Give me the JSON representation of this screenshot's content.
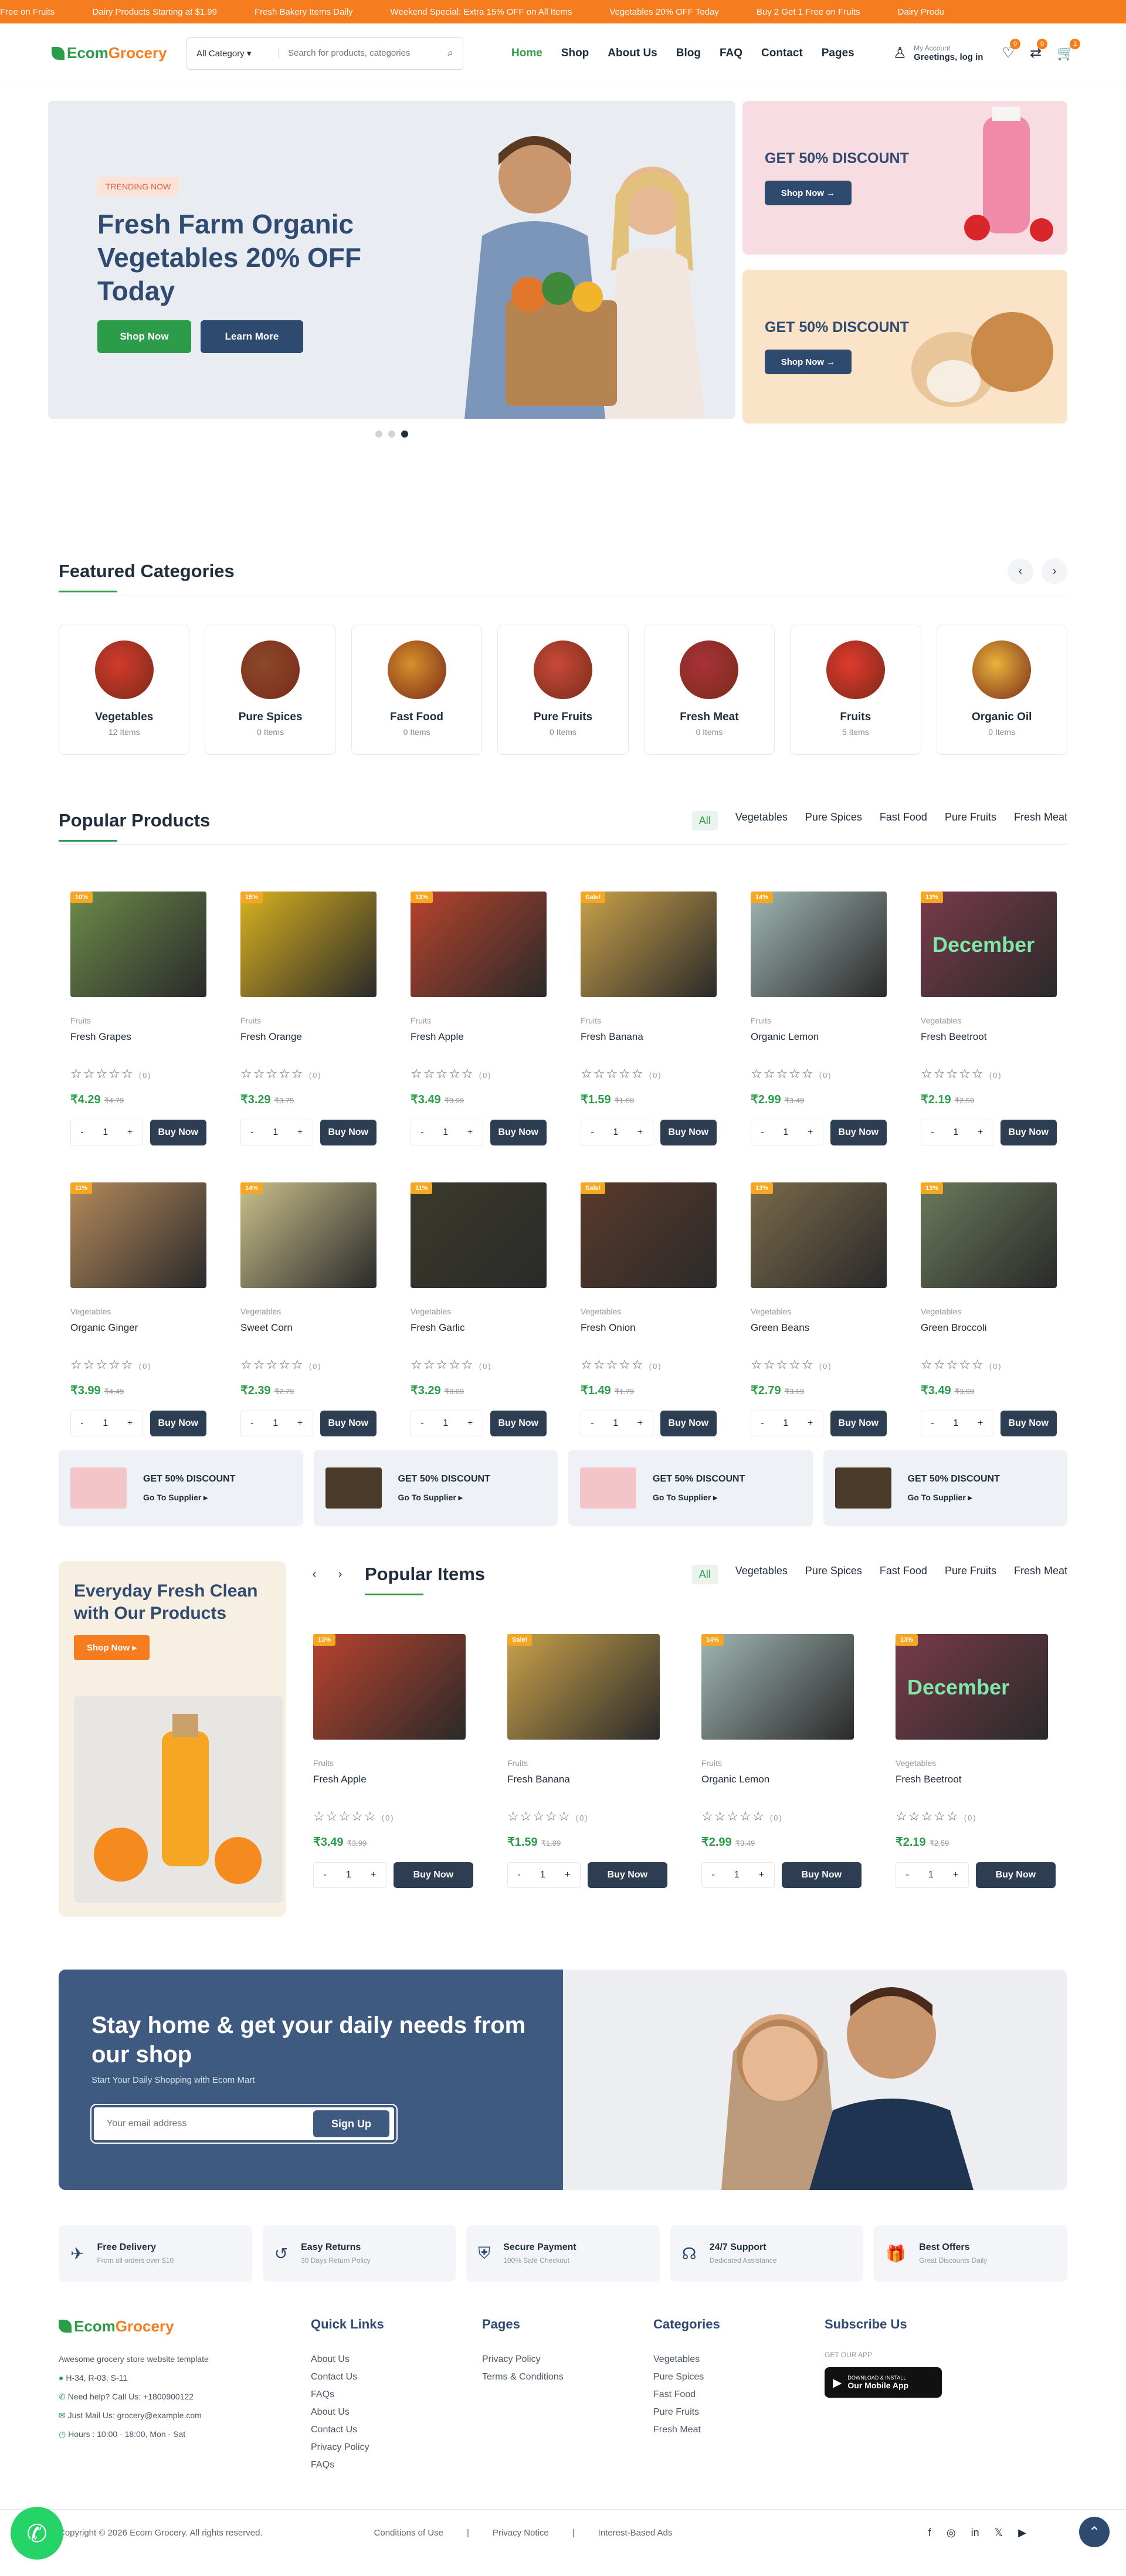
{
  "ticker": [
    "Free on Fruits",
    "Dairy Products Starting at $1.99",
    "Fresh Bakery Items Daily",
    "Weekend Special: Extra 15% OFF on All Items",
    "Vegetables 20% OFF Today",
    "Buy 2 Get 1 Free on Fruits",
    "Dairy Produ"
  ],
  "header": {
    "logo_a": "Ecom",
    "logo_b": "Grocery",
    "category": "All Category",
    "search_placeholder": "Search for products, categories",
    "account_small": "My Account",
    "account_big": "Greetings, log in",
    "wish_count": "0",
    "compare_count": "0",
    "cart_count": "1"
  },
  "nav": [
    "Home",
    "Shop",
    "About Us",
    "Blog",
    "FAQ",
    "Contact",
    "Pages"
  ],
  "hero": {
    "badge": "TRENDING NOW",
    "title": "Fresh Farm Organic Vegetables 20% OFF Today",
    "shop_btn": "Shop Now",
    "learn_btn": "Learn More",
    "side1_title": "GET 50% DISCOUNT",
    "side1_btn": "Shop Now →",
    "side2_title": "GET 50% DISCOUNT",
    "side2_btn": "Shop Now →"
  },
  "featured": {
    "title": "Featured Categories",
    "items": [
      {
        "name": "Vegetables",
        "count": "12 Items",
        "color": "#d33b2c"
      },
      {
        "name": "Pure Spices",
        "count": "0 Items",
        "color": "#8b4a2a"
      },
      {
        "name": "Fast Food",
        "count": "0 Items",
        "color": "#d6902a"
      },
      {
        "name": "Pure Fruits",
        "count": "0 Items",
        "color": "#c94a3a"
      },
      {
        "name": "Fresh Meat",
        "count": "0 Items",
        "color": "#a8323a"
      },
      {
        "name": "Fruits",
        "count": "5 Items",
        "color": "#e03a2c"
      },
      {
        "name": "Organic Oil",
        "count": "0 Items",
        "color": "#e8b43a"
      }
    ]
  },
  "tabs": [
    "All",
    "Vegetables",
    "Pure Spices",
    "Fast Food",
    "Pure Fruits",
    "Fresh Meat"
  ],
  "popular_products": {
    "title": "Popular Products",
    "items": [
      {
        "badge": "10%",
        "cat": "Fruits",
        "name": "Fresh Grapes",
        "price": "₹4.29",
        "old": "₹4.79",
        "color": "#6c8b4a"
      },
      {
        "badge": "15%",
        "cat": "Fruits",
        "name": "Fresh Orange",
        "price": "₹3.29",
        "old": "₹3.75",
        "color": "#d9b21f"
      },
      {
        "badge": "13%",
        "cat": "Fruits",
        "name": "Fresh Apple",
        "price": "₹3.49",
        "old": "₹3.99",
        "color": "#b8432c"
      },
      {
        "badge": "Sale!",
        "cat": "Fruits",
        "name": "Fresh Banana",
        "price": "₹1.59",
        "old": "₹1.89",
        "color": "#c9a24a"
      },
      {
        "badge": "14%",
        "cat": "Fruits",
        "name": "Organic Lemon",
        "price": "₹2.99",
        "old": "₹3.49",
        "color": "#9fb6b2"
      },
      {
        "badge": "13%",
        "cat": "Vegetables",
        "name": "Fresh Beetroot",
        "price": "₹2.19",
        "old": "₹2.59",
        "color": "#7a3a4a"
      },
      {
        "badge": "11%",
        "cat": "Vegetables",
        "name": "Organic Ginger",
        "price": "₹3.99",
        "old": "₹4.49",
        "color": "#b58a5a"
      },
      {
        "badge": "14%",
        "cat": "Vegetables",
        "name": "Sweet Corn",
        "price": "₹2.39",
        "old": "₹2.79",
        "color": "#c9c08a"
      },
      {
        "badge": "11%",
        "cat": "Vegetables",
        "name": "Fresh Garlic",
        "price": "₹3.29",
        "old": "₹3.69",
        "color": "#3a3a2a"
      },
      {
        "badge": "Sale!",
        "cat": "Vegetables",
        "name": "Fresh Onion",
        "price": "₹1.49",
        "old": "₹1.79",
        "color": "#5a3a2a"
      },
      {
        "badge": "13%",
        "cat": "Vegetables",
        "name": "Green Beans",
        "price": "₹2.79",
        "old": "₹3.19",
        "color": "#7a6a4a"
      },
      {
        "badge": "13%",
        "cat": "Vegetables",
        "name": "Green Broccoli",
        "price": "₹3.49",
        "old": "₹3.99",
        "color": "#6a7a5a"
      }
    ]
  },
  "stars": "☆☆☆☆☆",
  "reviews": "(0)",
  "qty": {
    "minus": "-",
    "value": "1",
    "plus": "+"
  },
  "buy": "Buy Now",
  "promos": [
    {
      "title": "GET 50% DISCOUNT",
      "link": "Go To Supplier ▸",
      "color": "#f3c5c8"
    },
    {
      "title": "GET 50% DISCOUNT",
      "link": "Go To Supplier ▸",
      "color": "#4a3a2a"
    },
    {
      "title": "GET 50% DISCOUNT",
      "link": "Go To Supplier ▸",
      "color": "#f3c5c8"
    },
    {
      "title": "GET 50% DISCOUNT",
      "link": "Go To Supplier ▸",
      "color": "#4a3a2a"
    }
  ],
  "popular_items": {
    "title": "Popular Items",
    "side_title": "Everyday Fresh Clean with Our Products",
    "side_btn": "Shop Now ▸",
    "items": [
      {
        "badge": "13%",
        "cat": "Fruits",
        "name": "Fresh Apple",
        "price": "₹3.49",
        "old": "₹3.99",
        "color": "#b8432c"
      },
      {
        "badge": "Sale!",
        "cat": "Fruits",
        "name": "Fresh Banana",
        "price": "₹1.59",
        "old": "₹1.89",
        "color": "#c9a24a"
      },
      {
        "badge": "14%",
        "cat": "Fruits",
        "name": "Organic Lemon",
        "price": "₹2.99",
        "old": "₹3.49",
        "color": "#9fb6b2"
      },
      {
        "badge": "13%",
        "cat": "Vegetables",
        "name": "Fresh Beetroot",
        "price": "₹2.19",
        "old": "₹2.59",
        "color": "#7a3a4a"
      }
    ]
  },
  "beetroot_overlay": "December",
  "newsletter": {
    "title": "Stay home & get your daily needs from our shop",
    "subtitle": "Start Your Daily Shopping with Ecom Mart",
    "placeholder": "Your email address",
    "button": "Sign Up"
  },
  "features": [
    {
      "title": "Free Delivery",
      "sub": "From all orders over $10",
      "icon": "✈"
    },
    {
      "title": "Easy Returns",
      "sub": "30 Days Return Policy",
      "icon": "↺"
    },
    {
      "title": "Secure Payment",
      "sub": "100% Safe Checkout",
      "icon": "⛨"
    },
    {
      "title": "24/7 Support",
      "sub": "Dedicated Assistance",
      "icon": "☊"
    },
    {
      "title": "Best Offers",
      "sub": "Great Discounts Daily",
      "icon": "🎁"
    }
  ],
  "footer": {
    "about": "Awesome grocery store website template",
    "address": "H-34, R-03, S-11",
    "help": "Need help? Call Us: +1800900122",
    "mail": "Just Mail Us: grocery@example.com",
    "hours": "Hours : 10:00 - 18:00, Mon - Sat",
    "quick_title": "Quick Links",
    "quick": [
      "About Us",
      "Contact Us",
      "FAQs",
      "About Us",
      "Contact Us",
      "Privacy Policy",
      "FAQs"
    ],
    "pages_title": "Pages",
    "pages": [
      "Privacy Policy",
      "Terms & Conditions"
    ],
    "cats_title": "Categories",
    "cats": [
      "Vegetables",
      "Pure Spices",
      "Fast Food",
      "Pure Fruits",
      "Fresh Meat"
    ],
    "sub_title": "Subscribe Us",
    "get_app": "GET OUR APP",
    "app_small": "DOWNLOAD & INSTALL",
    "app_big": "Our Mobile App"
  },
  "bottom": {
    "copyright": "Copyright © 2026 Ecom Grocery. All rights reserved.",
    "links": [
      "Conditions of Use",
      "|",
      "Privacy Notice",
      "|",
      "Interest-Based Ads"
    ],
    "social": [
      "f",
      "◎",
      "in",
      "𝕏",
      "▶"
    ]
  }
}
